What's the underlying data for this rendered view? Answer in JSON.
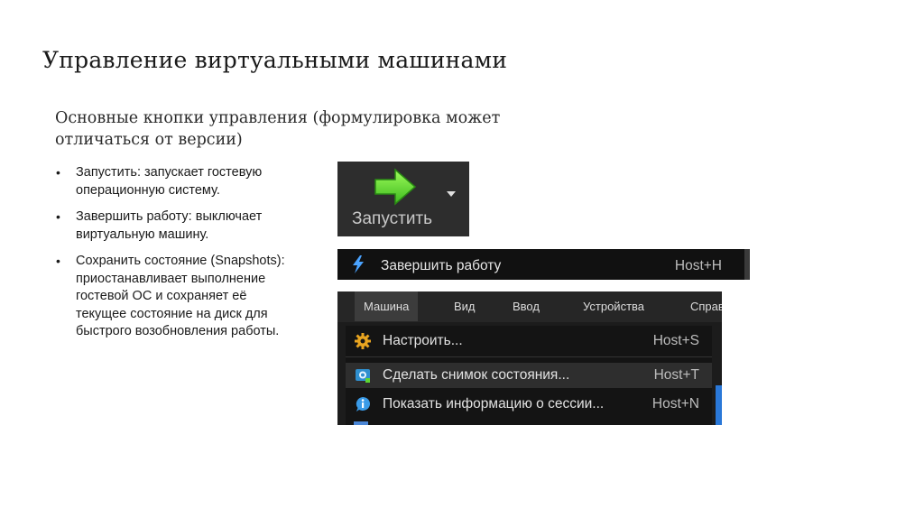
{
  "slide": {
    "title": "Управление виртуальными машинами",
    "subtitle": "Основные кнопки управления (формулировка может отличаться от версии)"
  },
  "bullets": [
    "Запустить: запускает гостевую операционную систему.",
    "Завершить работу: выключает виртуальную машину.",
    "Сохранить состояние (Snapshots): приостанавливает выполнение гостевой ОС и сохраняет её текущее состояние на диск для быстрого возобновления работы."
  ],
  "launch_button": {
    "label": "Запустить",
    "icon": "green-arrow-right-icon"
  },
  "shutdown_item": {
    "label": "Завершить работу",
    "shortcut": "Host+H",
    "icon": "lightning-bolt-icon"
  },
  "menubar": {
    "items": [
      "Машина",
      "Вид",
      "Ввод",
      "Устройства",
      "Справ"
    ],
    "active": "Машина"
  },
  "machine_menu": {
    "items": [
      {
        "label": "Настроить...",
        "shortcut": "Host+S",
        "icon": "gear-icon"
      },
      {
        "label": "Сделать снимок состояния...",
        "shortcut": "Host+T",
        "icon": "snapshot-icon"
      },
      {
        "label": "Показать информацию о сессии...",
        "shortcut": "Host+N",
        "icon": "info-icon"
      }
    ]
  },
  "colors": {
    "arrow_green": "#5ed633",
    "bolt_blue": "#4aa3ff",
    "gear_orange": "#e8a420",
    "accent_blue": "#2a78d8"
  }
}
